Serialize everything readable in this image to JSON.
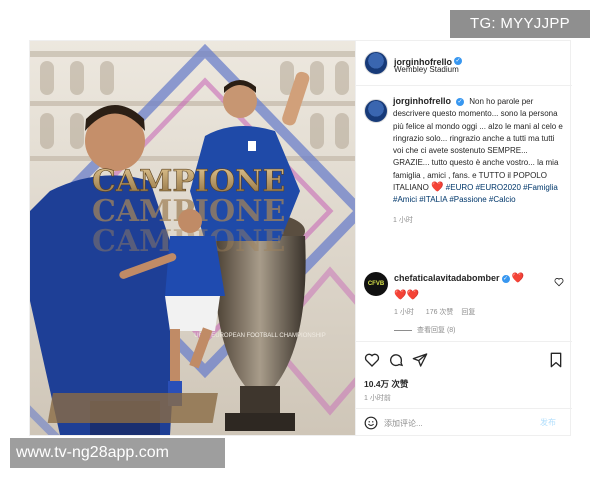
{
  "watermark_top": "TG: MYYJJPP",
  "watermark_bottom": "www.tv-ng28app.com",
  "post": {
    "image": {
      "headline": "CAMPIONE",
      "trophy_text": "UEFA EUROPEAN FOOTBALL CHAMPIONSHIP"
    },
    "header": {
      "username": "jorginhofrello",
      "location": "Wembley Stadium"
    },
    "caption": {
      "username": "jorginhofrello",
      "text": "Non ho parole per descrivere questo momento... sono la persona più felice al mondo oggi ... alzo le mani al celo e ringrazio solo... ringrazio anche a tutti ma tutti voi che ci avete sostenuto SEMPRE... GRAZIE... tutto questo è anche vostro... la mia famiglia , amici , fans. e TUTTO il POPOLO ITALIANO ",
      "hashtags": "#EURO #EURO2020 #Famiglia #Amici #ITALIA #Passione #Calcio",
      "time": "1 小时"
    },
    "comment": {
      "username": "chefaticalavitadabomber",
      "avatar_text": "CFVB",
      "time": "1 小时",
      "likes": "176 次赞",
      "reply": "回复",
      "view_replies": "查看回复 (8)"
    },
    "actions": {
      "likes": "10.4万 次赞",
      "time": "1 小时前"
    },
    "add_comment": {
      "placeholder": "添加评论...",
      "publish": "发布"
    },
    "colors": {
      "verified": "#3897f0",
      "heart": "#ed4956",
      "hashtag": "#00376b",
      "publish": "#b2dffc"
    }
  }
}
